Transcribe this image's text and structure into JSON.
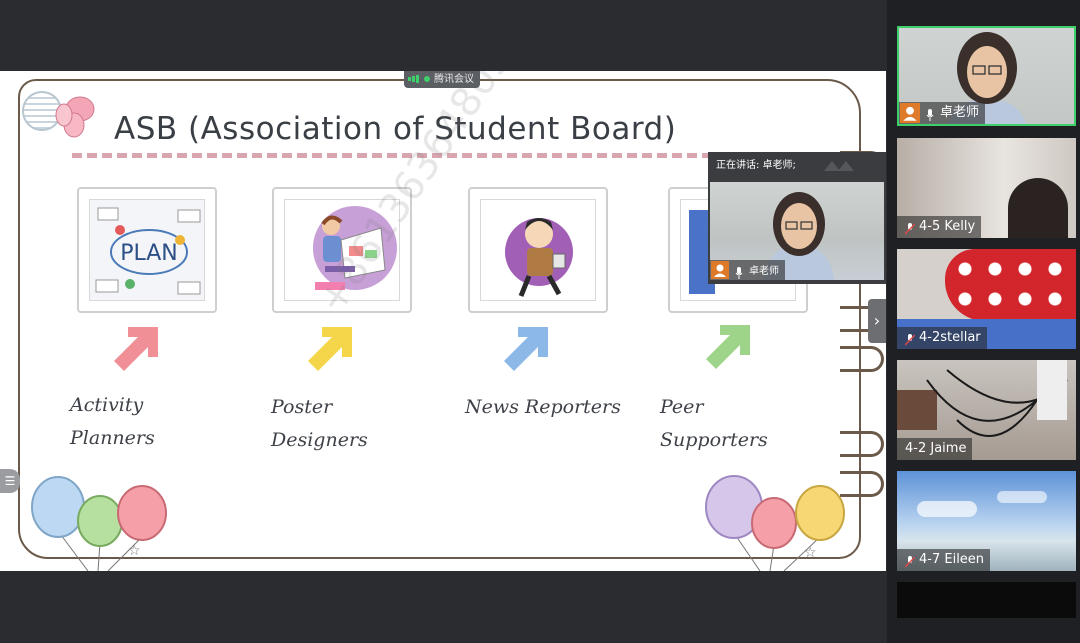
{
  "slide": {
    "title": "ASB (Association of Student Board)",
    "roles": [
      {
        "line1": "Activity",
        "line2": "Planners"
      },
      {
        "line1": "Poster",
        "line2": "Designers"
      },
      {
        "line1": "News Reporters",
        "line2": ""
      },
      {
        "line1": "Peer",
        "line2": "Supporters"
      }
    ],
    "plan_text": "PLAN",
    "arrow_colors": [
      "#f08f95",
      "#f5d64a",
      "#8cb8e8",
      "#9ed48a"
    ],
    "watermark": "+8613636480598要根"
  },
  "meeting": {
    "app_badge": "腾讯会议"
  },
  "speaker": {
    "header": "正在讲话: 卓老师;",
    "name": "卓老师"
  },
  "participants": [
    {
      "name": "卓老师",
      "muted": false
    },
    {
      "name": "4-5 Kelly",
      "muted": true
    },
    {
      "name": "4-2stellar",
      "muted": true
    },
    {
      "name": "4-2 Jaime",
      "muted": false
    },
    {
      "name": "4-7 Eileen",
      "muted": true
    },
    {
      "name": "",
      "muted": false
    }
  ]
}
